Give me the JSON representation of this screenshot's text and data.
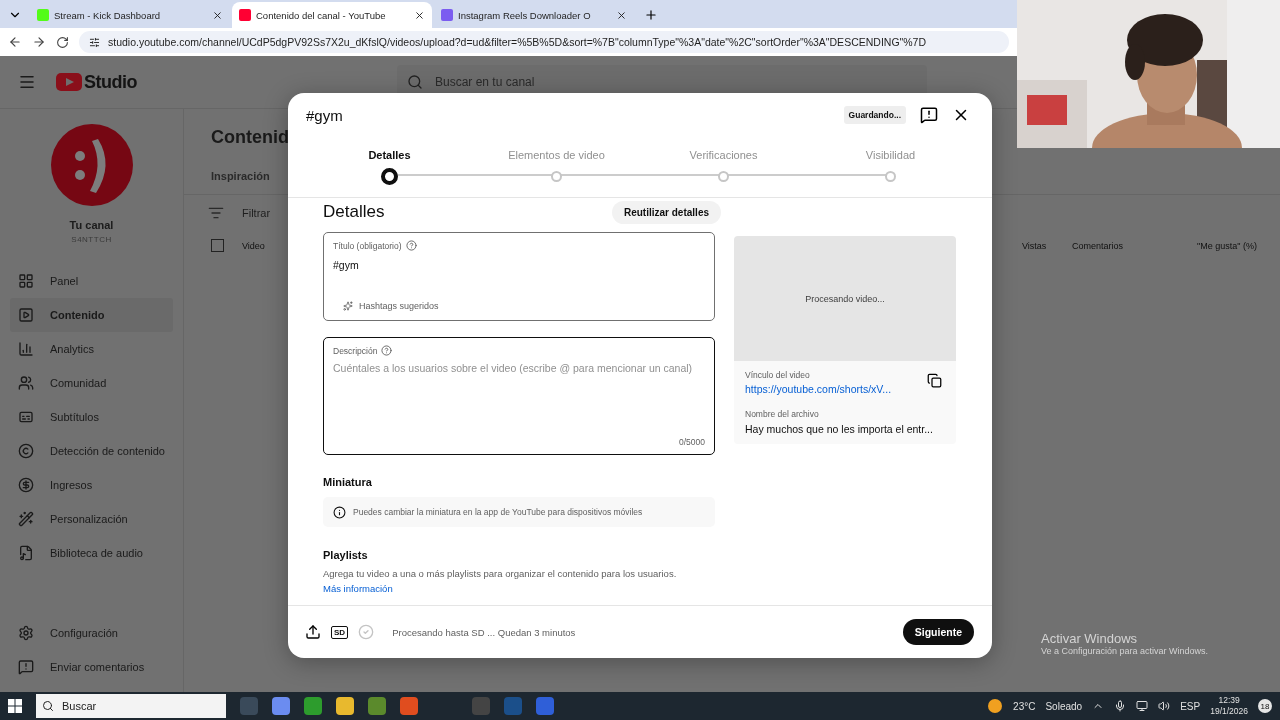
{
  "browser": {
    "tabs": [
      {
        "label": "Stream - Kick Dashboard",
        "selected": false
      },
      {
        "label": "Contenido del canal - YouTube",
        "selected": true
      },
      {
        "label": "Instagram Reels Downloader O",
        "selected": false
      }
    ],
    "url": "studio.youtube.com/channel/UCdP5dgPV92Ss7X2u_dKfslQ/videos/upload?d=ud&filter=%5B%5D&sort=%7B\"columnType\"%3A\"date\"%2C\"sortOrder\"%3A\"DESCENDING\"%7D"
  },
  "studio": {
    "logo": "Studio",
    "search_placeholder": "Buscar en tu canal",
    "channel": {
      "name": "Tu canal",
      "handle": "S4NTTCH"
    },
    "nav": [
      {
        "label": "Panel",
        "selected": false
      },
      {
        "label": "Contenido",
        "selected": true
      },
      {
        "label": "Analytics",
        "selected": false
      },
      {
        "label": "Comunidad",
        "selected": false
      },
      {
        "label": "Subtítulos",
        "selected": false
      },
      {
        "label": "Detección de contenido",
        "selected": false
      },
      {
        "label": "Ingresos",
        "selected": false
      },
      {
        "label": "Personalización",
        "selected": false
      },
      {
        "label": "Biblioteca de audio",
        "selected": false
      }
    ],
    "footer_nav": [
      "Configuración",
      "Enviar comentarios"
    ],
    "page_title": "Contenid",
    "tab": "Inspiración",
    "filter_placeholder": "Filtrar",
    "select_all_checked": false,
    "columns": [
      "Video",
      "Vistas",
      "Comentarios",
      "\"Me gusta\" (%)"
    ]
  },
  "dialog": {
    "title": "#gym",
    "status_chip": "Guardando...",
    "steps": [
      {
        "label": "Detalles",
        "selected": true
      },
      {
        "label": "Elementos de video",
        "selected": false
      },
      {
        "label": "Verificaciones",
        "selected": false
      },
      {
        "label": "Visibilidad",
        "selected": false
      }
    ],
    "heading": "Detalles",
    "reuse_button": "Reutilizar detalles",
    "title_field": {
      "label": "Título (obligatorio)",
      "value": "#gym",
      "hashtags_button": "Hashtags sugeridos"
    },
    "description_field": {
      "label": "Descripción",
      "placeholder": "Cuéntales a los usuarios sobre el video (escribe @ para mencionar un canal)",
      "counter": "0/5000"
    },
    "thumbnail": {
      "heading": "Miniatura",
      "info": "Puedes cambiar la miniatura en la app de YouTube para dispositivos móviles"
    },
    "playlists": {
      "heading": "Playlists",
      "text": "Agrega tu video a una o más playlists para organizar el contenido para los usuarios.",
      "link": "Más información"
    },
    "preview": {
      "status": "Procesando video...",
      "link_label": "Vínculo del video",
      "link": "https://youtube.com/shorts/xV...",
      "file_label": "Nombre del archivo",
      "file_name": "Hay muchos que no les importa el entr..."
    },
    "footer": {
      "sd_badge": "SD",
      "status": "Procesando hasta SD ... Quedan 3 minutos",
      "next_button": "Siguiente"
    }
  },
  "watermark": {
    "title": "Activar Windows",
    "text": "Ve a Configuración para activar Windows."
  },
  "taskbar": {
    "search_placeholder": "Buscar",
    "temperature": "23°C",
    "weather": "Soleado",
    "language": "ESP",
    "time": "12:39",
    "date": "19/1/2026",
    "notifications": "18"
  }
}
